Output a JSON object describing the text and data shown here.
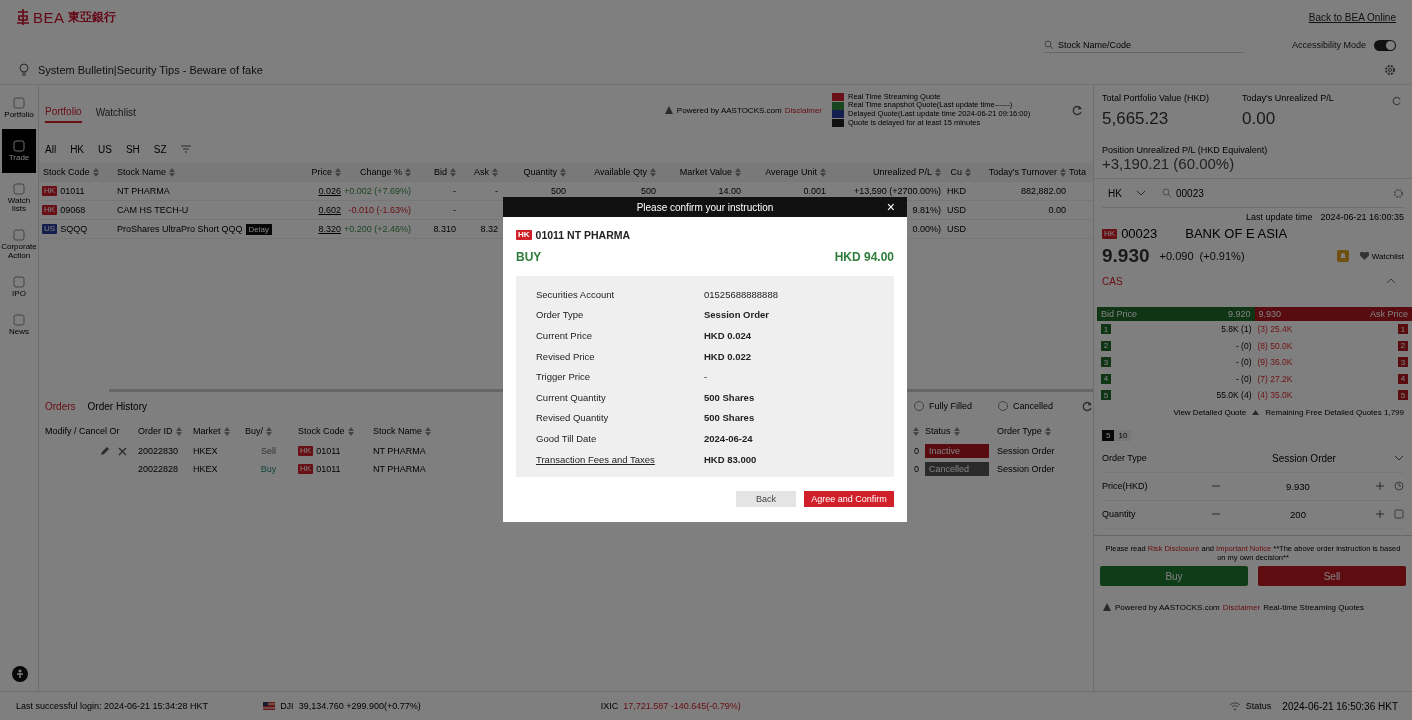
{
  "header": {
    "logo_text": "BEA",
    "logo_chinese": "東亞銀行",
    "back_link": "Back to BEA Online"
  },
  "toolbar": {
    "search": {
      "placeholder": "Stock Name/Code"
    },
    "accessibility": {
      "label": "Accessibility Mode",
      "on": true
    }
  },
  "bulletin": "System Bulletin|Security Tips - Beware of fake",
  "rail": [
    {
      "label": "Portfolio",
      "selected": false
    },
    {
      "label": "Trade",
      "selected": true
    },
    {
      "label": "Watch lists",
      "selected": false
    },
    {
      "label": "Corporate Action",
      "selected": false
    },
    {
      "label": "IPO",
      "selected": false
    },
    {
      "label": "News",
      "selected": false
    }
  ],
  "portfolio_tabs": [
    {
      "label": "Portfolio",
      "selected": true
    },
    {
      "label": "Watchlist",
      "selected": false
    }
  ],
  "powered_by": {
    "text": "Powered by AASTOCKS.com",
    "link": "Disclaimer"
  },
  "legend": [
    {
      "kind": "streaming",
      "text": "Real Time Streaming Quote"
    },
    {
      "kind": "snapshot",
      "text": "Real Time snapshot Quote(Last update time------)"
    },
    {
      "kind": "delayed",
      "text": "Delayed Quote(Last update time 2024-06-21 09:16:00)"
    },
    {
      "kind": "notice",
      "text": "Quote is delayed for at least 15 minutes"
    }
  ],
  "market_filters": [
    "All",
    "HK",
    "US",
    "SH",
    "SZ"
  ],
  "holdings": {
    "columns": [
      "Stock Code",
      "Stock Name",
      "Price",
      "Change %",
      "Bid",
      "Ask",
      "Quantity",
      "Available Qty",
      "Market Value",
      "Average Unit",
      "Unrealized P/L",
      "Cu",
      "Today's Turnover",
      "Tota"
    ],
    "rows": [
      {
        "market": "HK",
        "code": "01011",
        "name": "NT PHARMA",
        "price": "0.026",
        "change": "+0.002 (+7.69%)",
        "kind": "up",
        "bid": "-",
        "ask": "-",
        "quantity": "500",
        "available_qty": "500",
        "market_value": "14.00",
        "average_unit": "0.001",
        "unrealized_pl": "+13,590 (+2700.00%)",
        "currency": "HKD",
        "turnover": "882,882.00"
      },
      {
        "market": "HK",
        "code": "09068",
        "name": "CAM HS TECH-U",
        "price": "0.602",
        "change": "-0.010 (-1.63%)",
        "kind": "down",
        "bid": "-",
        "unrealized_pl": "9.81%)",
        "currency": "USD",
        "turnover": "0.00"
      },
      {
        "market": "US",
        "code": "SQQQ",
        "name": "ProShares UltraPro Short QQQ",
        "badge": "Delay",
        "price": "8.320",
        "change": "+0.200 (+2.46%)",
        "kind": "up",
        "bid": "8.310",
        "ask": "8.32",
        "unrealized_pl": "0.00%)",
        "currency": "USD"
      }
    ]
  },
  "orders": {
    "tabs": [
      {
        "label": "Orders",
        "selected": true
      },
      {
        "label": "Order History",
        "selected": false
      }
    ],
    "filters": [
      {
        "label": "Fully Filled",
        "checked": false
      },
      {
        "label": "Cancelled",
        "checked": false
      }
    ],
    "columns": [
      "Modify / Cancel Or",
      "Order ID",
      "Market",
      "Buy/",
      "Stock Code",
      "Stock Name",
      "Status",
      "Order Type"
    ],
    "rows": [
      {
        "editable": true,
        "order_id": "20022830",
        "market": "HKEX",
        "side": "Sell",
        "kind": "sell",
        "code_market": "HK",
        "code": "01011",
        "name": "NT PHARMA",
        "filled": "0",
        "status": "Inactive",
        "cancelled": false,
        "order_type": "Session Order"
      },
      {
        "editable": false,
        "order_id": "20022828",
        "market": "HKEX",
        "side": "Buy",
        "kind": "buy",
        "code_market": "HK",
        "code": "01011",
        "name": "NT PHARMA",
        "filled": "0",
        "status": "Cancelled",
        "cancelled": true,
        "order_type": "Session Order"
      }
    ]
  },
  "summary": {
    "total_label": "Total Portfolio Value (HKD)",
    "total": "5,665.23",
    "today_label": "Today's Unrealized P/L",
    "today": "0.00",
    "position_label": "Position Unrealized P/L (HKD Equivalent)",
    "position": "+3,190.21 (60.00%)"
  },
  "quote": {
    "market": "HK",
    "search": "00023",
    "update_label": "Last update time",
    "update_time": "2024-06-21 16:00:35",
    "badge": "HK",
    "code": "00023",
    "name": "BANK OF E ASIA",
    "price": "9.930",
    "change": "+0.090  (+0.91%)",
    "watchlist": "Watchlist",
    "cas": "CAS"
  },
  "depth": {
    "bid_label": "Bid Price",
    "bid": "9.920",
    "ask": "9.930",
    "ask_label": "Ask Price",
    "rows": [
      {
        "bid_level": "1",
        "bid": "5.8K (1)",
        "ask": "(3) 25.4K",
        "ask_level": "1"
      },
      {
        "bid_level": "2",
        "bid": "- (0)",
        "ask": "(8) 50.0K",
        "ask_level": "2"
      },
      {
        "bid_level": "3",
        "bid": "- (0)",
        "ask": "(9) 36.0K",
        "ask_level": "3"
      },
      {
        "bid_level": "4",
        "bid": "- (0)",
        "ask": "(7) 27.2K",
        "ask_level": "4"
      },
      {
        "bid_level": "5",
        "bid": "55.0K (4)",
        "ask": "(4) 35.0K",
        "ask_level": "5"
      }
    ],
    "view_link": "View Detailed Quote",
    "remaining": "Remaining Free Detailed Quotes 1,799"
  },
  "depth_tabs": [
    {
      "label": "5",
      "selected": true
    },
    {
      "label": "10",
      "selected": false
    }
  ],
  "order_form": {
    "order_type_label": "Order Type",
    "order_type": "Session Order",
    "price_label": "Price(HKD)",
    "price": "9.930",
    "quantity_label": "Quantity",
    "quantity": "200"
  },
  "disclaimer": {
    "prefix": "Please read",
    "risk": "Risk Disclosure",
    "and": "and",
    "notice": "Important Notice",
    "suffix": "**The above order instruction is based on my own decision**"
  },
  "trade_buttons": [
    "Buy",
    "Sell"
  ],
  "quote_source": {
    "text": "Powered by AASTOCKS.com",
    "link": "Disclaimer",
    "suffix": "Real-time Streaming Quotes"
  },
  "footer": {
    "login": "Last successful login: 2024-06-21 15:34:28 HKT",
    "dji_label": "DJI",
    "dji": "39,134.760 +299.900(+0.77%)",
    "ixic_label": "IXIC",
    "ixic": "17,721.587 -140.645(-0.79%)",
    "status_label": "Status",
    "time": "2024-06-21 16:50:36 HKT"
  },
  "modal": {
    "title": "Please confirm your instruction",
    "close": "×",
    "market": "HK",
    "stock": "01011 NT PHARMA",
    "action": "BUY",
    "amount": "HKD 94.00",
    "rows": [
      {
        "label": "Securities Account",
        "value": "01525688888888",
        "bold": false
      },
      {
        "label": "Order Type",
        "value": "Session Order",
        "bold": true
      },
      {
        "label": "Current Price",
        "value": "HKD 0.024",
        "bold": true
      },
      {
        "label": "Revised Price",
        "value": "HKD 0.022",
        "bold": true
      },
      {
        "label": "Trigger Price",
        "value": "-",
        "bold": false
      },
      {
        "label": "Current Quantity",
        "value": "500 Shares",
        "bold": true
      },
      {
        "label": "Revised Quantity",
        "value": "500 Shares",
        "bold": true
      },
      {
        "label": "Good Till Date",
        "value": "2024-06-24",
        "bold": true
      },
      {
        "label": "Transaction Fees and Taxes",
        "kind": "link",
        "value": "HKD 83.000",
        "bold": true
      }
    ],
    "buttons": [
      {
        "label": "Back",
        "kind": "secondary"
      },
      {
        "label": "Agree and Confirm",
        "kind": "primary"
      }
    ]
  }
}
